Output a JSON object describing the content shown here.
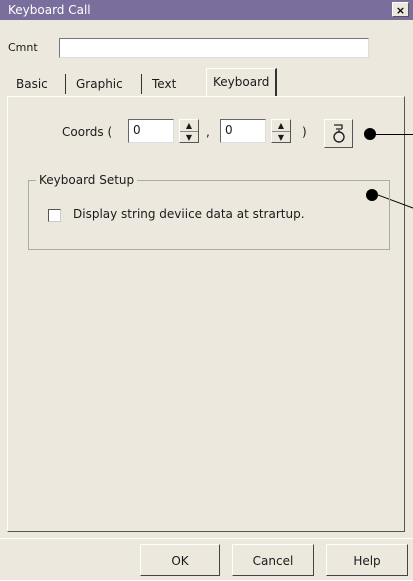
{
  "window": {
    "title": "Keyboard Call",
    "close_glyph": "×"
  },
  "comment": {
    "label": "Cmnt",
    "value": ""
  },
  "tabs": [
    {
      "label": "Basic",
      "active": false
    },
    {
      "label": "Graphic",
      "active": false
    },
    {
      "label": "Text",
      "active": false
    },
    {
      "label": "Keyboard",
      "active": true
    }
  ],
  "coords": {
    "label": "Coords (",
    "x": "0",
    "y": "0",
    "comma": ",",
    "close_paren": ")"
  },
  "keyboard_setup": {
    "group_label": "Keyboard Setup",
    "checkbox_label": "Display string deviice data at strartup.",
    "checked": false
  },
  "buttons": {
    "ok": "OK",
    "cancel": "Cancel",
    "help": "Help"
  }
}
